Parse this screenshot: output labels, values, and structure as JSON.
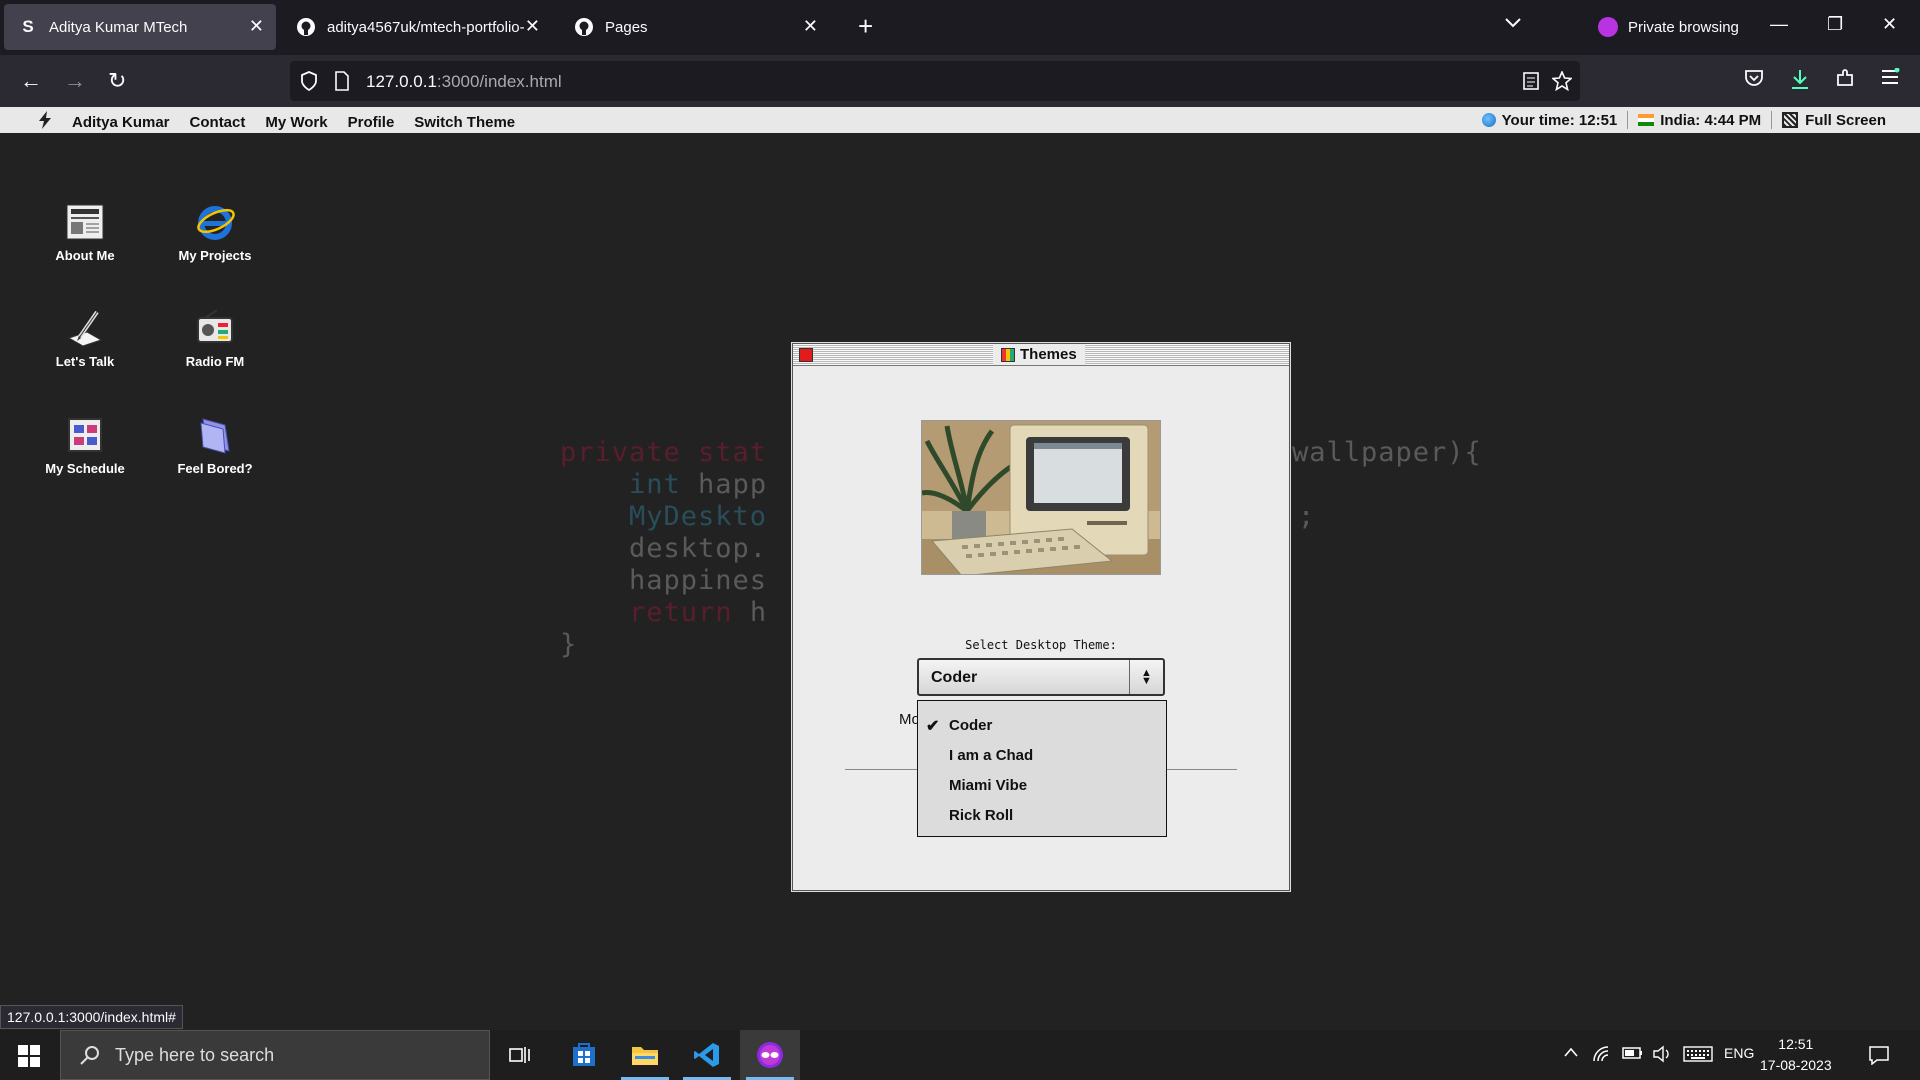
{
  "browser": {
    "tabs": [
      {
        "title": "Aditya Kumar MTech",
        "favicon": "S",
        "active": true
      },
      {
        "title": "aditya4567uk/mtech-portfolio-",
        "favicon": "github-icon",
        "active": false
      },
      {
        "title": "Pages",
        "favicon": "github-icon",
        "active": false
      }
    ],
    "private_label": "Private browsing",
    "url_host": "127.0.0.1",
    "url_rest": ":3000/index.html"
  },
  "menubar": {
    "brand": "Aditya Kumar",
    "items": [
      "Contact",
      "My Work",
      "Profile",
      "Switch Theme"
    ],
    "your_time_label": "Your time:",
    "your_time": "12:51",
    "india_label": "India:",
    "india_time": "4:44 PM",
    "fullscreen": "Full Screen"
  },
  "desktop_icons": [
    {
      "label": "About Me",
      "icon": "newspaper-icon"
    },
    {
      "label": "My Projects",
      "icon": "internet-explorer-icon"
    },
    {
      "label": "Let's Talk",
      "icon": "pen-paper-icon"
    },
    {
      "label": "Radio FM",
      "icon": "radio-icon"
    },
    {
      "label": "My Schedule",
      "icon": "schedule-icon"
    },
    {
      "label": "Feel Bored?",
      "icon": "folder-icon"
    }
  ],
  "code_bg": {
    "line1_a": "private stat",
    "line1_b": "wallpaper){",
    "line2": "    int happ",
    "line3": "    MyDeskto",
    "line3_b": ";",
    "line4": "    desktop.",
    "line5": "    happines",
    "line6": "    return h",
    "line7": "}"
  },
  "themes_window": {
    "title": "Themes",
    "select_label": "Select Desktop Theme:",
    "selected": "Coder",
    "partial_text": "Mo",
    "options": [
      "Coder",
      "I am a Chad",
      "Miami Vibe",
      "Rick Roll"
    ]
  },
  "status_url": "127.0.0.1:3000/index.html#",
  "taskbar": {
    "search_placeholder": "Type here to search",
    "lang": "ENG",
    "time": "12:51",
    "date": "17-08-2023"
  }
}
